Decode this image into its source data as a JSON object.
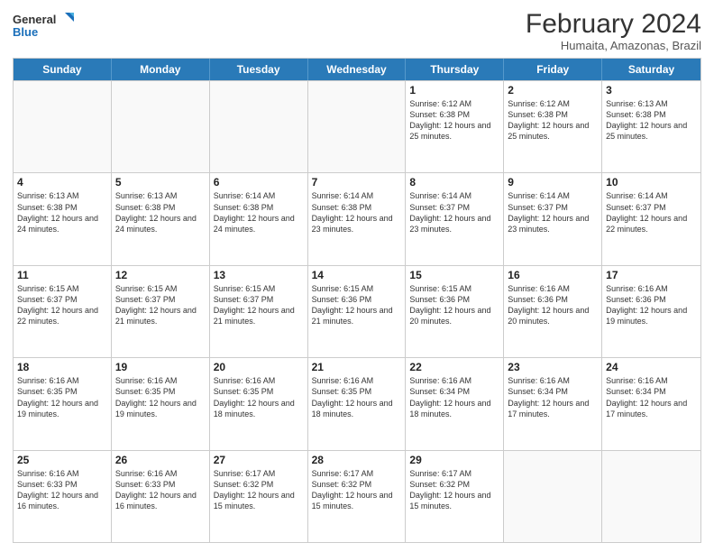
{
  "logo": {
    "line1": "General",
    "line2": "Blue"
  },
  "title": "February 2024",
  "subtitle": "Humaita, Amazonas, Brazil",
  "days_of_week": [
    "Sunday",
    "Monday",
    "Tuesday",
    "Wednesday",
    "Thursday",
    "Friday",
    "Saturday"
  ],
  "weeks": [
    [
      {
        "day": "",
        "info": ""
      },
      {
        "day": "",
        "info": ""
      },
      {
        "day": "",
        "info": ""
      },
      {
        "day": "",
        "info": ""
      },
      {
        "day": "1",
        "info": "Sunrise: 6:12 AM\nSunset: 6:38 PM\nDaylight: 12 hours and 25 minutes."
      },
      {
        "day": "2",
        "info": "Sunrise: 6:12 AM\nSunset: 6:38 PM\nDaylight: 12 hours and 25 minutes."
      },
      {
        "day": "3",
        "info": "Sunrise: 6:13 AM\nSunset: 6:38 PM\nDaylight: 12 hours and 25 minutes."
      }
    ],
    [
      {
        "day": "4",
        "info": "Sunrise: 6:13 AM\nSunset: 6:38 PM\nDaylight: 12 hours and 24 minutes."
      },
      {
        "day": "5",
        "info": "Sunrise: 6:13 AM\nSunset: 6:38 PM\nDaylight: 12 hours and 24 minutes."
      },
      {
        "day": "6",
        "info": "Sunrise: 6:14 AM\nSunset: 6:38 PM\nDaylight: 12 hours and 24 minutes."
      },
      {
        "day": "7",
        "info": "Sunrise: 6:14 AM\nSunset: 6:38 PM\nDaylight: 12 hours and 23 minutes."
      },
      {
        "day": "8",
        "info": "Sunrise: 6:14 AM\nSunset: 6:37 PM\nDaylight: 12 hours and 23 minutes."
      },
      {
        "day": "9",
        "info": "Sunrise: 6:14 AM\nSunset: 6:37 PM\nDaylight: 12 hours and 23 minutes."
      },
      {
        "day": "10",
        "info": "Sunrise: 6:14 AM\nSunset: 6:37 PM\nDaylight: 12 hours and 22 minutes."
      }
    ],
    [
      {
        "day": "11",
        "info": "Sunrise: 6:15 AM\nSunset: 6:37 PM\nDaylight: 12 hours and 22 minutes."
      },
      {
        "day": "12",
        "info": "Sunrise: 6:15 AM\nSunset: 6:37 PM\nDaylight: 12 hours and 21 minutes."
      },
      {
        "day": "13",
        "info": "Sunrise: 6:15 AM\nSunset: 6:37 PM\nDaylight: 12 hours and 21 minutes."
      },
      {
        "day": "14",
        "info": "Sunrise: 6:15 AM\nSunset: 6:36 PM\nDaylight: 12 hours and 21 minutes."
      },
      {
        "day": "15",
        "info": "Sunrise: 6:15 AM\nSunset: 6:36 PM\nDaylight: 12 hours and 20 minutes."
      },
      {
        "day": "16",
        "info": "Sunrise: 6:16 AM\nSunset: 6:36 PM\nDaylight: 12 hours and 20 minutes."
      },
      {
        "day": "17",
        "info": "Sunrise: 6:16 AM\nSunset: 6:36 PM\nDaylight: 12 hours and 19 minutes."
      }
    ],
    [
      {
        "day": "18",
        "info": "Sunrise: 6:16 AM\nSunset: 6:35 PM\nDaylight: 12 hours and 19 minutes."
      },
      {
        "day": "19",
        "info": "Sunrise: 6:16 AM\nSunset: 6:35 PM\nDaylight: 12 hours and 19 minutes."
      },
      {
        "day": "20",
        "info": "Sunrise: 6:16 AM\nSunset: 6:35 PM\nDaylight: 12 hours and 18 minutes."
      },
      {
        "day": "21",
        "info": "Sunrise: 6:16 AM\nSunset: 6:35 PM\nDaylight: 12 hours and 18 minutes."
      },
      {
        "day": "22",
        "info": "Sunrise: 6:16 AM\nSunset: 6:34 PM\nDaylight: 12 hours and 18 minutes."
      },
      {
        "day": "23",
        "info": "Sunrise: 6:16 AM\nSunset: 6:34 PM\nDaylight: 12 hours and 17 minutes."
      },
      {
        "day": "24",
        "info": "Sunrise: 6:16 AM\nSunset: 6:34 PM\nDaylight: 12 hours and 17 minutes."
      }
    ],
    [
      {
        "day": "25",
        "info": "Sunrise: 6:16 AM\nSunset: 6:33 PM\nDaylight: 12 hours and 16 minutes."
      },
      {
        "day": "26",
        "info": "Sunrise: 6:16 AM\nSunset: 6:33 PM\nDaylight: 12 hours and 16 minutes."
      },
      {
        "day": "27",
        "info": "Sunrise: 6:17 AM\nSunset: 6:32 PM\nDaylight: 12 hours and 15 minutes."
      },
      {
        "day": "28",
        "info": "Sunrise: 6:17 AM\nSunset: 6:32 PM\nDaylight: 12 hours and 15 minutes."
      },
      {
        "day": "29",
        "info": "Sunrise: 6:17 AM\nSunset: 6:32 PM\nDaylight: 12 hours and 15 minutes."
      },
      {
        "day": "",
        "info": ""
      },
      {
        "day": "",
        "info": ""
      }
    ]
  ]
}
